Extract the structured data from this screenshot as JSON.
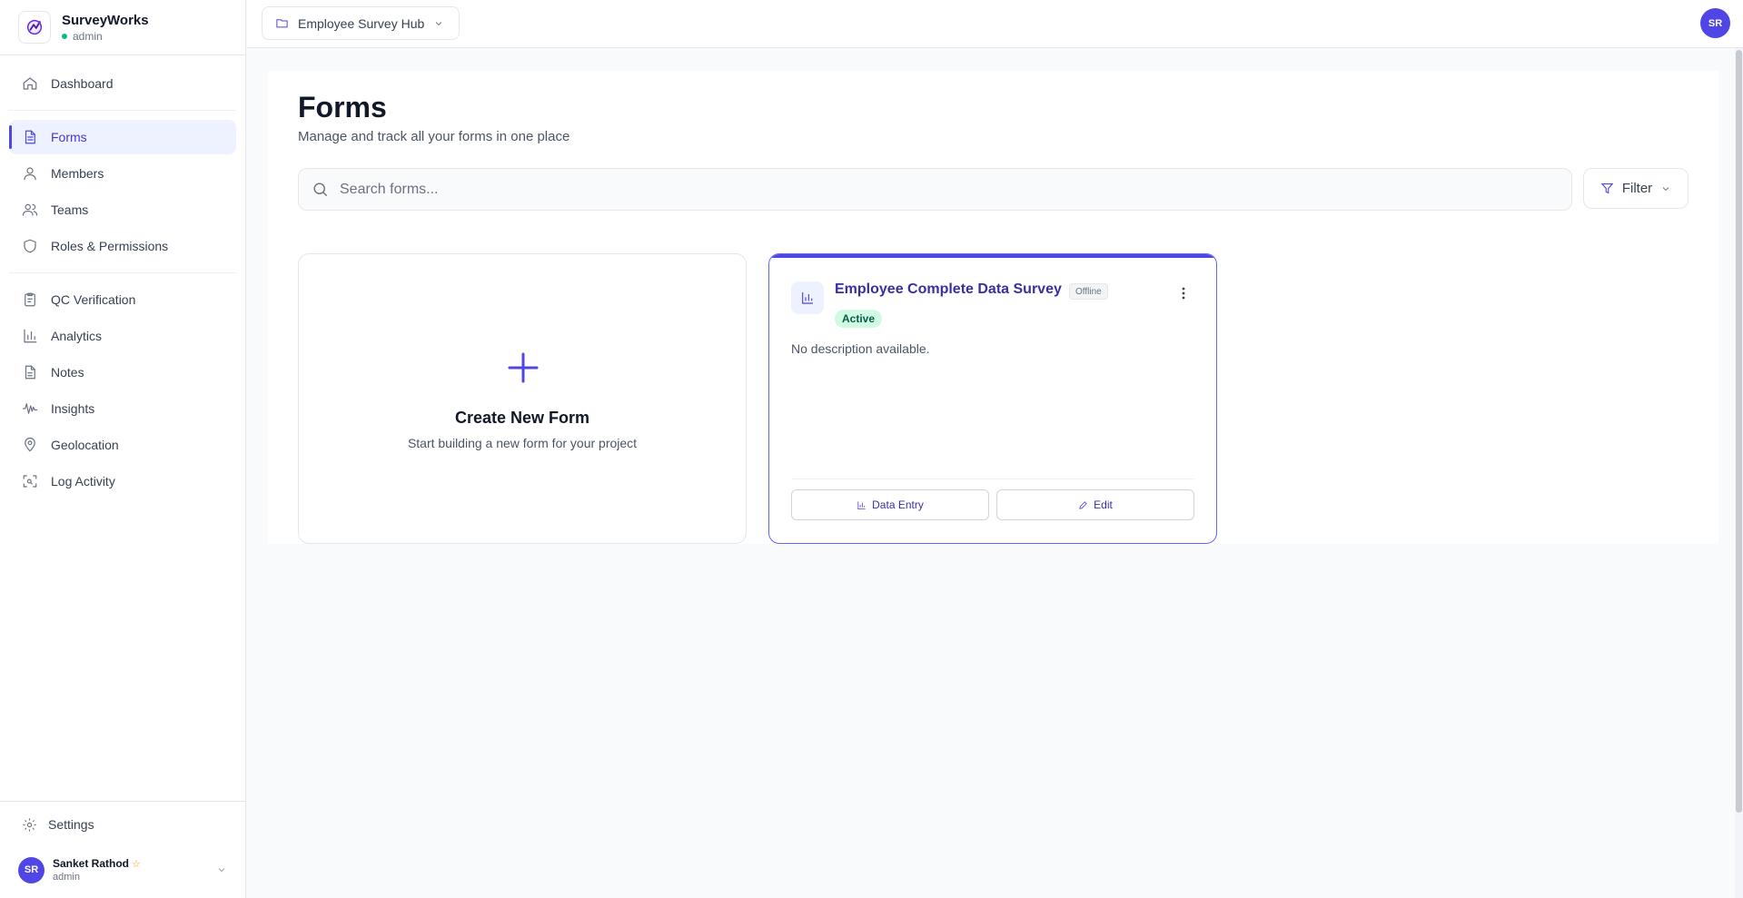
{
  "brand": {
    "name": "SurveyWorks",
    "role": "admin"
  },
  "sidebar": {
    "groups": [
      [
        {
          "label": "Dashboard",
          "icon": "home-icon"
        }
      ],
      [
        {
          "label": "Forms",
          "icon": "document-icon",
          "active": true
        },
        {
          "label": "Members",
          "icon": "user-icon"
        },
        {
          "label": "Teams",
          "icon": "users-icon"
        },
        {
          "label": "Roles & Permissions",
          "icon": "shield-icon"
        }
      ],
      [
        {
          "label": "QC Verification",
          "icon": "clipboard-check-icon"
        },
        {
          "label": "Analytics",
          "icon": "bar-chart-icon"
        },
        {
          "label": "Notes",
          "icon": "note-icon"
        },
        {
          "label": "Insights",
          "icon": "waveform-icon"
        },
        {
          "label": "Geolocation",
          "icon": "map-pin-icon"
        },
        {
          "label": "Log Activity",
          "icon": "scan-icon"
        }
      ]
    ],
    "settings_label": "Settings",
    "user": {
      "initials": "SR",
      "name": "Sanket Rathod",
      "role": "admin"
    }
  },
  "topbar": {
    "project": "Employee Survey Hub",
    "avatar_initials": "SR"
  },
  "main": {
    "title": "Forms",
    "subtitle": "Manage and track all your forms in one place",
    "search_placeholder": "Search forms...",
    "filter_label": "Filter",
    "create_card": {
      "title": "Create New Form",
      "subtitle": "Start building a new form for your project"
    },
    "forms": [
      {
        "title": "Employee Complete Data Survey",
        "mode_badge": "Offline",
        "status": "Active",
        "description": "No description available.",
        "data_entry_label": "Data Entry",
        "edit_label": "Edit"
      }
    ]
  },
  "colors": {
    "accent": "#4f46e5",
    "active_bg": "#eef2ff",
    "status_active_bg": "#d1fae5",
    "status_active_text": "#065f46"
  }
}
